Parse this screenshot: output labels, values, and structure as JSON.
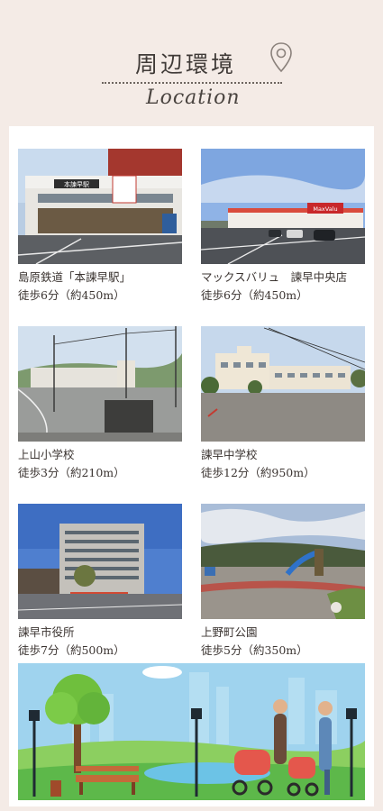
{
  "header": {
    "title": "周辺環境",
    "subtitle": "Location",
    "pin_icon": "map-pin-icon"
  },
  "places": [
    {
      "name": "島原鉄道「本諫早駅」",
      "distance": "徒歩6分（約450m）",
      "photo": "station-photo",
      "sign": "本諫早駅"
    },
    {
      "name": "マックスバリュ　諫早中央店",
      "distance": "徒歩6分（約450m）",
      "photo": "supermarket-photo",
      "sign": "MaxValu"
    },
    {
      "name": "上山小学校",
      "distance": "徒歩3分（約210m）",
      "photo": "elementary-school-photo"
    },
    {
      "name": "諫早中学校",
      "distance": "徒歩12分（約950m）",
      "photo": "junior-high-school-photo"
    },
    {
      "name": "諫早市役所",
      "distance": "徒歩7分（約500m）",
      "photo": "city-hall-photo"
    },
    {
      "name": "上野町公園",
      "distance": "徒歩5分（約350m）",
      "photo": "park-photo"
    }
  ],
  "colors": {
    "background": "#f4ebe6",
    "panel": "#ffffff",
    "text": "#3b3431"
  }
}
